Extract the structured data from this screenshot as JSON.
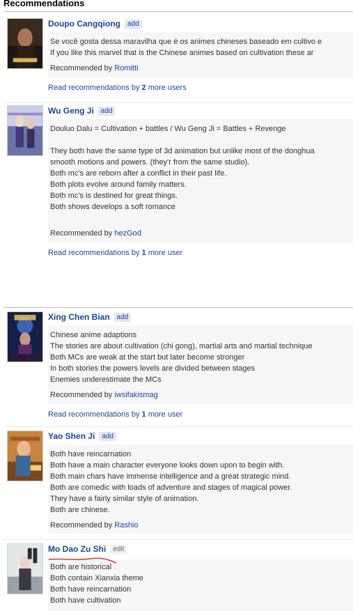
{
  "section_title": "Recommendations",
  "recommendations": [
    {
      "title": "Doupo Cangqiong",
      "action_label": "add",
      "lines": [
        "Se você gosta dessa maravilha que é os animes chineses baseado em cultivo e",
        "If you like this marvel that is the Chinese animes based on cultivation these ar"
      ],
      "recommended_by_prefix": "Recommended by",
      "recommended_by_user": "Romitti",
      "more_prefix": "Read recommendations by",
      "more_count": "2",
      "more_suffix": "more users"
    },
    {
      "title": "Wu Geng Ji",
      "action_label": "add",
      "lines": [
        "Douluo Dalu = Cultivation + battles / Wu Geng Ji = Battles + Revenge",
        "",
        "They both have the same type of 3d animation but unlike most of the donghua",
        "smooth motions and powers. (they'r from the same studio).",
        "Both mc's are reborn after a conflict in their past life.",
        "Both plots evolve around family matters.",
        "Both mc's is destined for great things.",
        "Both shows develops a soft romance",
        ""
      ],
      "recommended_by_prefix": "Recommended by",
      "recommended_by_user": "hezGod",
      "more_prefix": "Read recommendations by",
      "more_count": "1",
      "more_suffix": "more user"
    },
    {
      "title": "Xing Chen Bian",
      "action_label": "add",
      "lines": [
        "Chinese anime adaptions",
        "The stories are about cultivation (chi gong), martial arts and martial technique",
        "Both MCs are weak at the start but later become stronger",
        "In both stories the powers levels are divided between stages",
        "Enemies underestimate the MCs"
      ],
      "recommended_by_prefix": "Recommended by",
      "recommended_by_user": "iwsifakismag",
      "more_prefix": "Read recommendations by",
      "more_count": "1",
      "more_suffix": "more user"
    },
    {
      "title": "Yao Shen Ji",
      "action_label": "add",
      "lines": [
        "Both have reincarnation",
        "Both have a main character everyone looks down upon to begin with.",
        "Both main chars have immense intelligence and a great strategic mind.",
        "Both are comedic with loads of adventure and stages of magical power.",
        "They have a fairly similar style of animation.",
        "Both are chinese."
      ],
      "recommended_by_prefix": "Recommended by",
      "recommended_by_user": "Rashio"
    },
    {
      "title": "Mo Dao Zu Shi",
      "action_label": "edit",
      "lines": [
        "Both are historical",
        "Both contain Xianxia theme",
        "Both have reincarnation",
        "Both have cultivation"
      ]
    }
  ],
  "colors": {
    "link": "#1d439b",
    "text": "#323232",
    "body_bg": "#f6f6f6",
    "annotation": "#e0281e"
  }
}
